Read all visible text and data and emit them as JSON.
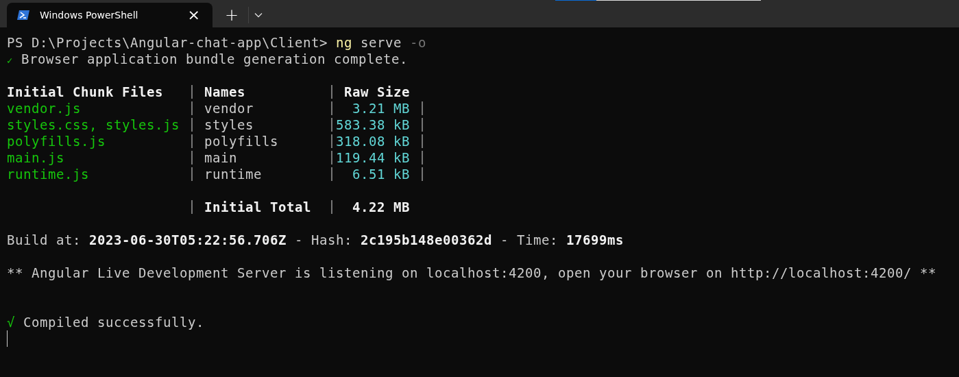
{
  "tab": {
    "title": "Windows PowerShell",
    "close": "×",
    "selected": true
  },
  "new_tab": "+",
  "terminal": {
    "prompt": {
      "path": "PS D:\\Projects\\Angular-chat-app\\Client>",
      "command": "ng",
      "args": "serve",
      "flag": "-o"
    },
    "bundle_status": {
      "icon": "✓",
      "text": "Browser application bundle generation complete."
    },
    "table": {
      "columns": [
        "Initial Chunk Files",
        "Names",
        "Raw Size"
      ],
      "rows": [
        {
          "kind": "file",
          "file": "vendor.js",
          "name": "vendor",
          "size": "3.21 MB"
        },
        {
          "kind": "file",
          "file": "styles.css, styles.js",
          "name": "styles",
          "size": "583.38 kB"
        },
        {
          "kind": "file",
          "file": "polyfills.js",
          "name": "polyfills",
          "size": "318.08 kB"
        },
        {
          "kind": "file",
          "file": "main.js",
          "name": "main",
          "size": "119.44 kB"
        },
        {
          "kind": "file",
          "file": "runtime.js",
          "name": "runtime",
          "size": "6.51 kB"
        },
        {
          "kind": "total",
          "file": "",
          "name": "Initial Total",
          "size": "4.22 MB"
        }
      ]
    },
    "build_info": "Build at: **2023-06-30T05:22:56.706Z** - Hash: **2c195b148e00362d** - Time: **17699ms**",
    "server_message": "** Angular Live Development Server is listening on localhost:4200, open your browser on http://localhost:4200/ **",
    "compiled": {
      "icon": "√",
      "text": "Compiled successfully."
    }
  }
}
